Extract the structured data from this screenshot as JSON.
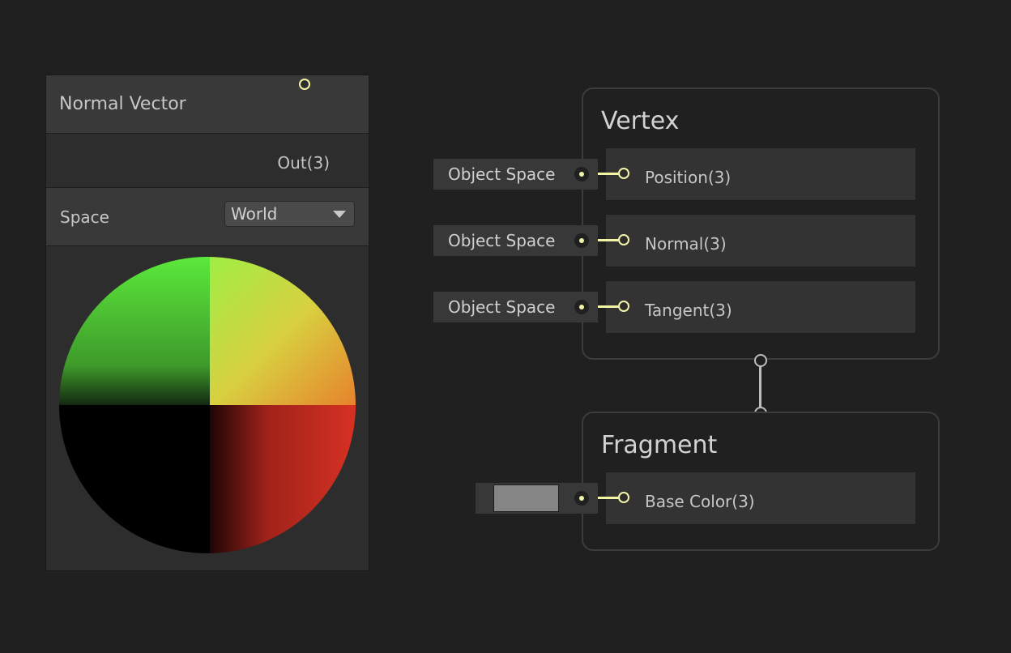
{
  "normal_vector_node": {
    "title": "Normal Vector",
    "output_port": "Out(3)",
    "property_label": "Space",
    "space_value": "World"
  },
  "vertex_context": {
    "title": "Vertex",
    "blocks": [
      {
        "label": "Position(3)",
        "input": "Object Space"
      },
      {
        "label": "Normal(3)",
        "input": "Object Space"
      },
      {
        "label": "Tangent(3)",
        "input": "Object Space"
      }
    ]
  },
  "fragment_context": {
    "title": "Fragment",
    "blocks": [
      {
        "label": "Base Color(3)",
        "input_color": "#858585"
      }
    ]
  },
  "colors": {
    "background": "#202020",
    "port_yellow": "#f3f4a6",
    "flow_connector": "#bdbdbd"
  }
}
